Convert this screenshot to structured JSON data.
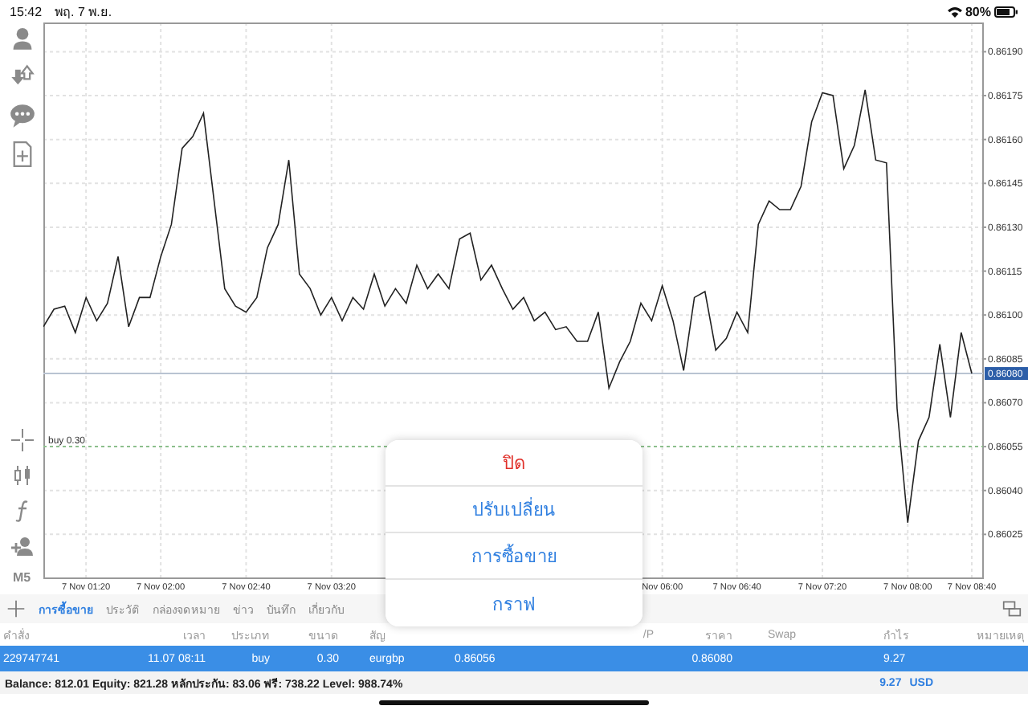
{
  "status_bar": {
    "time": "15:42",
    "date": "พฤ. 7 พ.ย.",
    "battery": "80%"
  },
  "toolbar": {
    "timeframe": "M5"
  },
  "chart": {
    "chart_data": {
      "type": "line",
      "categories": [
        null,
        null,
        null,
        null,
        "7 Nov 01:20",
        null,
        null,
        null,
        null,
        null,
        null,
        "7 Nov 02:00",
        null,
        null,
        null,
        null,
        null,
        null,
        null,
        "7 Nov 02:40",
        null,
        null,
        null,
        null,
        null,
        null,
        null,
        "7 Nov 03:20",
        null,
        null,
        null,
        null,
        null,
        null,
        null,
        null,
        null,
        null,
        null,
        null,
        null,
        null,
        null,
        null,
        null,
        null,
        null,
        null,
        null,
        null,
        null,
        null,
        null,
        null,
        null,
        null,
        null,
        null,
        "Nov 06:00",
        null,
        null,
        null,
        null,
        null,
        null,
        "7 Nov 06:40",
        null,
        null,
        null,
        null,
        null,
        null,
        null,
        "7 Nov 07:20",
        null,
        null,
        null,
        null,
        null,
        null,
        null,
        "7 Nov 08:00",
        null,
        null,
        null,
        null,
        null,
        "7 Nov 08:40"
      ],
      "grid": true,
      "values": [
        0.86096,
        0.86102,
        0.86103,
        0.86094,
        0.86106,
        0.86098,
        0.86104,
        0.8612,
        0.86096,
        0.86106,
        0.86106,
        0.8612,
        0.86131,
        0.86157,
        0.86161,
        0.86169,
        0.86139,
        0.86109,
        0.86103,
        0.86101,
        0.86106,
        0.86123,
        0.86131,
        0.86153,
        0.86114,
        0.86109,
        0.861,
        0.86106,
        0.86098,
        0.86106,
        0.86102,
        0.86114,
        0.86103,
        0.86109,
        0.86104,
        0.86117,
        0.86109,
        0.86114,
        0.86109,
        0.86126,
        0.86128,
        0.86112,
        0.86117,
        0.86109,
        0.86102,
        0.86106,
        0.86098,
        0.86101,
        0.86095,
        0.86096,
        0.86091,
        0.86091,
        0.86101,
        0.86075,
        0.86084,
        0.86091,
        0.86104,
        0.86098,
        0.8611,
        0.86098,
        0.86081,
        0.86106,
        0.86108,
        0.86088,
        0.86092,
        0.86101,
        0.86094,
        0.86131,
        0.86139,
        0.86136,
        0.86136,
        0.86144,
        0.86166,
        0.86176,
        0.86175,
        0.8615,
        0.86158,
        0.86177,
        0.86153,
        0.86152,
        0.86068,
        0.86029,
        0.86057,
        0.86065,
        0.8609,
        0.86065,
        0.86094,
        0.8608
      ],
      "ylim": [
        0.8601,
        0.862
      ],
      "yticks": [
        {
          "value": 0.8619,
          "label": "0.86190"
        },
        {
          "value": 0.86175,
          "label": "0.86175"
        },
        {
          "value": 0.8616,
          "label": "0.86160"
        },
        {
          "value": 0.86145,
          "label": "0.86145"
        },
        {
          "value": 0.8613,
          "label": "0.86130"
        },
        {
          "value": 0.86115,
          "label": "0.86115"
        },
        {
          "value": 0.861,
          "label": "0.86100"
        },
        {
          "value": 0.86085,
          "label": "0.86085"
        },
        {
          "value": 0.8607,
          "label": "0.86070"
        },
        {
          "value": 0.86055,
          "label": "0.86055"
        },
        {
          "value": 0.8604,
          "label": "0.86040"
        },
        {
          "value": 0.86025,
          "label": "0.86025"
        }
      ],
      "ref_lines": [
        {
          "axis": "y",
          "value": 0.8608,
          "label": "0.86080"
        },
        {
          "axis": "y",
          "value": 0.86055,
          "label": "buy 0.30"
        }
      ]
    }
  },
  "tabs": [
    {
      "label": "การซื้อขาย",
      "selected": true
    },
    {
      "label": "ประวัติ",
      "selected": false
    },
    {
      "label": "กล่องจดหมาย",
      "selected": false
    },
    {
      "label": "ข่าว",
      "selected": false
    },
    {
      "label": "บันทึก",
      "selected": false
    },
    {
      "label": "เกี่ยวกับ",
      "selected": false
    }
  ],
  "table": {
    "header": {
      "order": "คำสั่ง",
      "time": "เวลา",
      "type": "ประเภท",
      "volume": "ขนาด",
      "symbol": "สัญ",
      "tp": "/P",
      "price": "ราคา",
      "swap": "Swap",
      "profit": "กำไร",
      "comment": "หมายเหตุ"
    },
    "rows": [
      {
        "selected": true,
        "cells": {
          "order": "229747741",
          "time": "11.07 08:11",
          "type": "buy",
          "volume": "0.30",
          "symbol": "eurgbp",
          "open_price": "0.86056",
          "price": "0.86080",
          "profit": "9.27"
        }
      }
    ]
  },
  "summary": {
    "text": "Balance: 812.01 Equity: 821.28 หลักประกัน: 83.06 ฟรี: 738.22 Level: 988.74%",
    "profit": "9.27",
    "currency": "USD"
  },
  "context_menu": {
    "items": [
      {
        "label": "ปิด",
        "kind": "destructive"
      },
      {
        "label": "ปรับเปลี่ยน",
        "kind": "action"
      },
      {
        "label": "การซื้อขาย",
        "kind": "action"
      },
      {
        "label": "กราฟ",
        "kind": "action"
      }
    ]
  }
}
